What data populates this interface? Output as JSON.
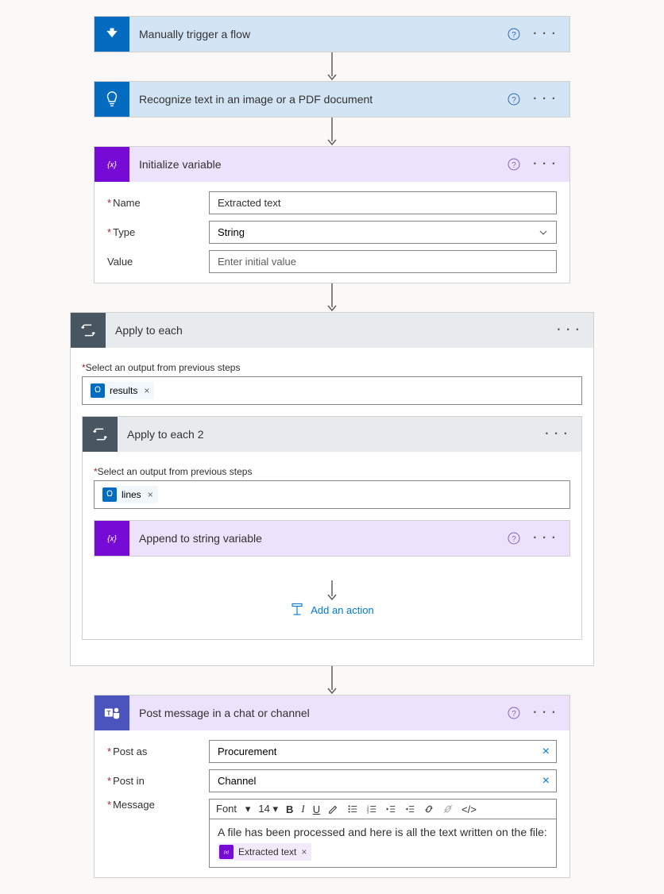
{
  "steps": {
    "trigger": {
      "title": "Manually trigger a flow"
    },
    "recognize": {
      "title": "Recognize text in an image or a PDF document"
    },
    "initVar": {
      "title": "Initialize variable",
      "nameLabel": "Name",
      "nameValue": "Extracted text",
      "typeLabel": "Type",
      "typeValue": "String",
      "valueLabel": "Value",
      "valuePlaceholder": "Enter initial value"
    },
    "applyEach": {
      "title": "Apply to each",
      "outputLabel": "Select an output from previous steps",
      "token": "results"
    },
    "applyEach2": {
      "title": "Apply to each 2",
      "outputLabel": "Select an output from previous steps",
      "token": "lines"
    },
    "append": {
      "title": "Append to string variable"
    },
    "addAction": "Add an action",
    "post": {
      "title": "Post message in a chat or channel",
      "postAsLabel": "Post as",
      "postAsValue": "Procurement",
      "postInLabel": "Post in",
      "postInValue": "Channel",
      "messageLabel": "Message",
      "rte": {
        "font": "Font",
        "size": "14"
      },
      "messageText": "A file has been processed and here is all the text written on the file:",
      "varChip": "Extracted text"
    }
  }
}
